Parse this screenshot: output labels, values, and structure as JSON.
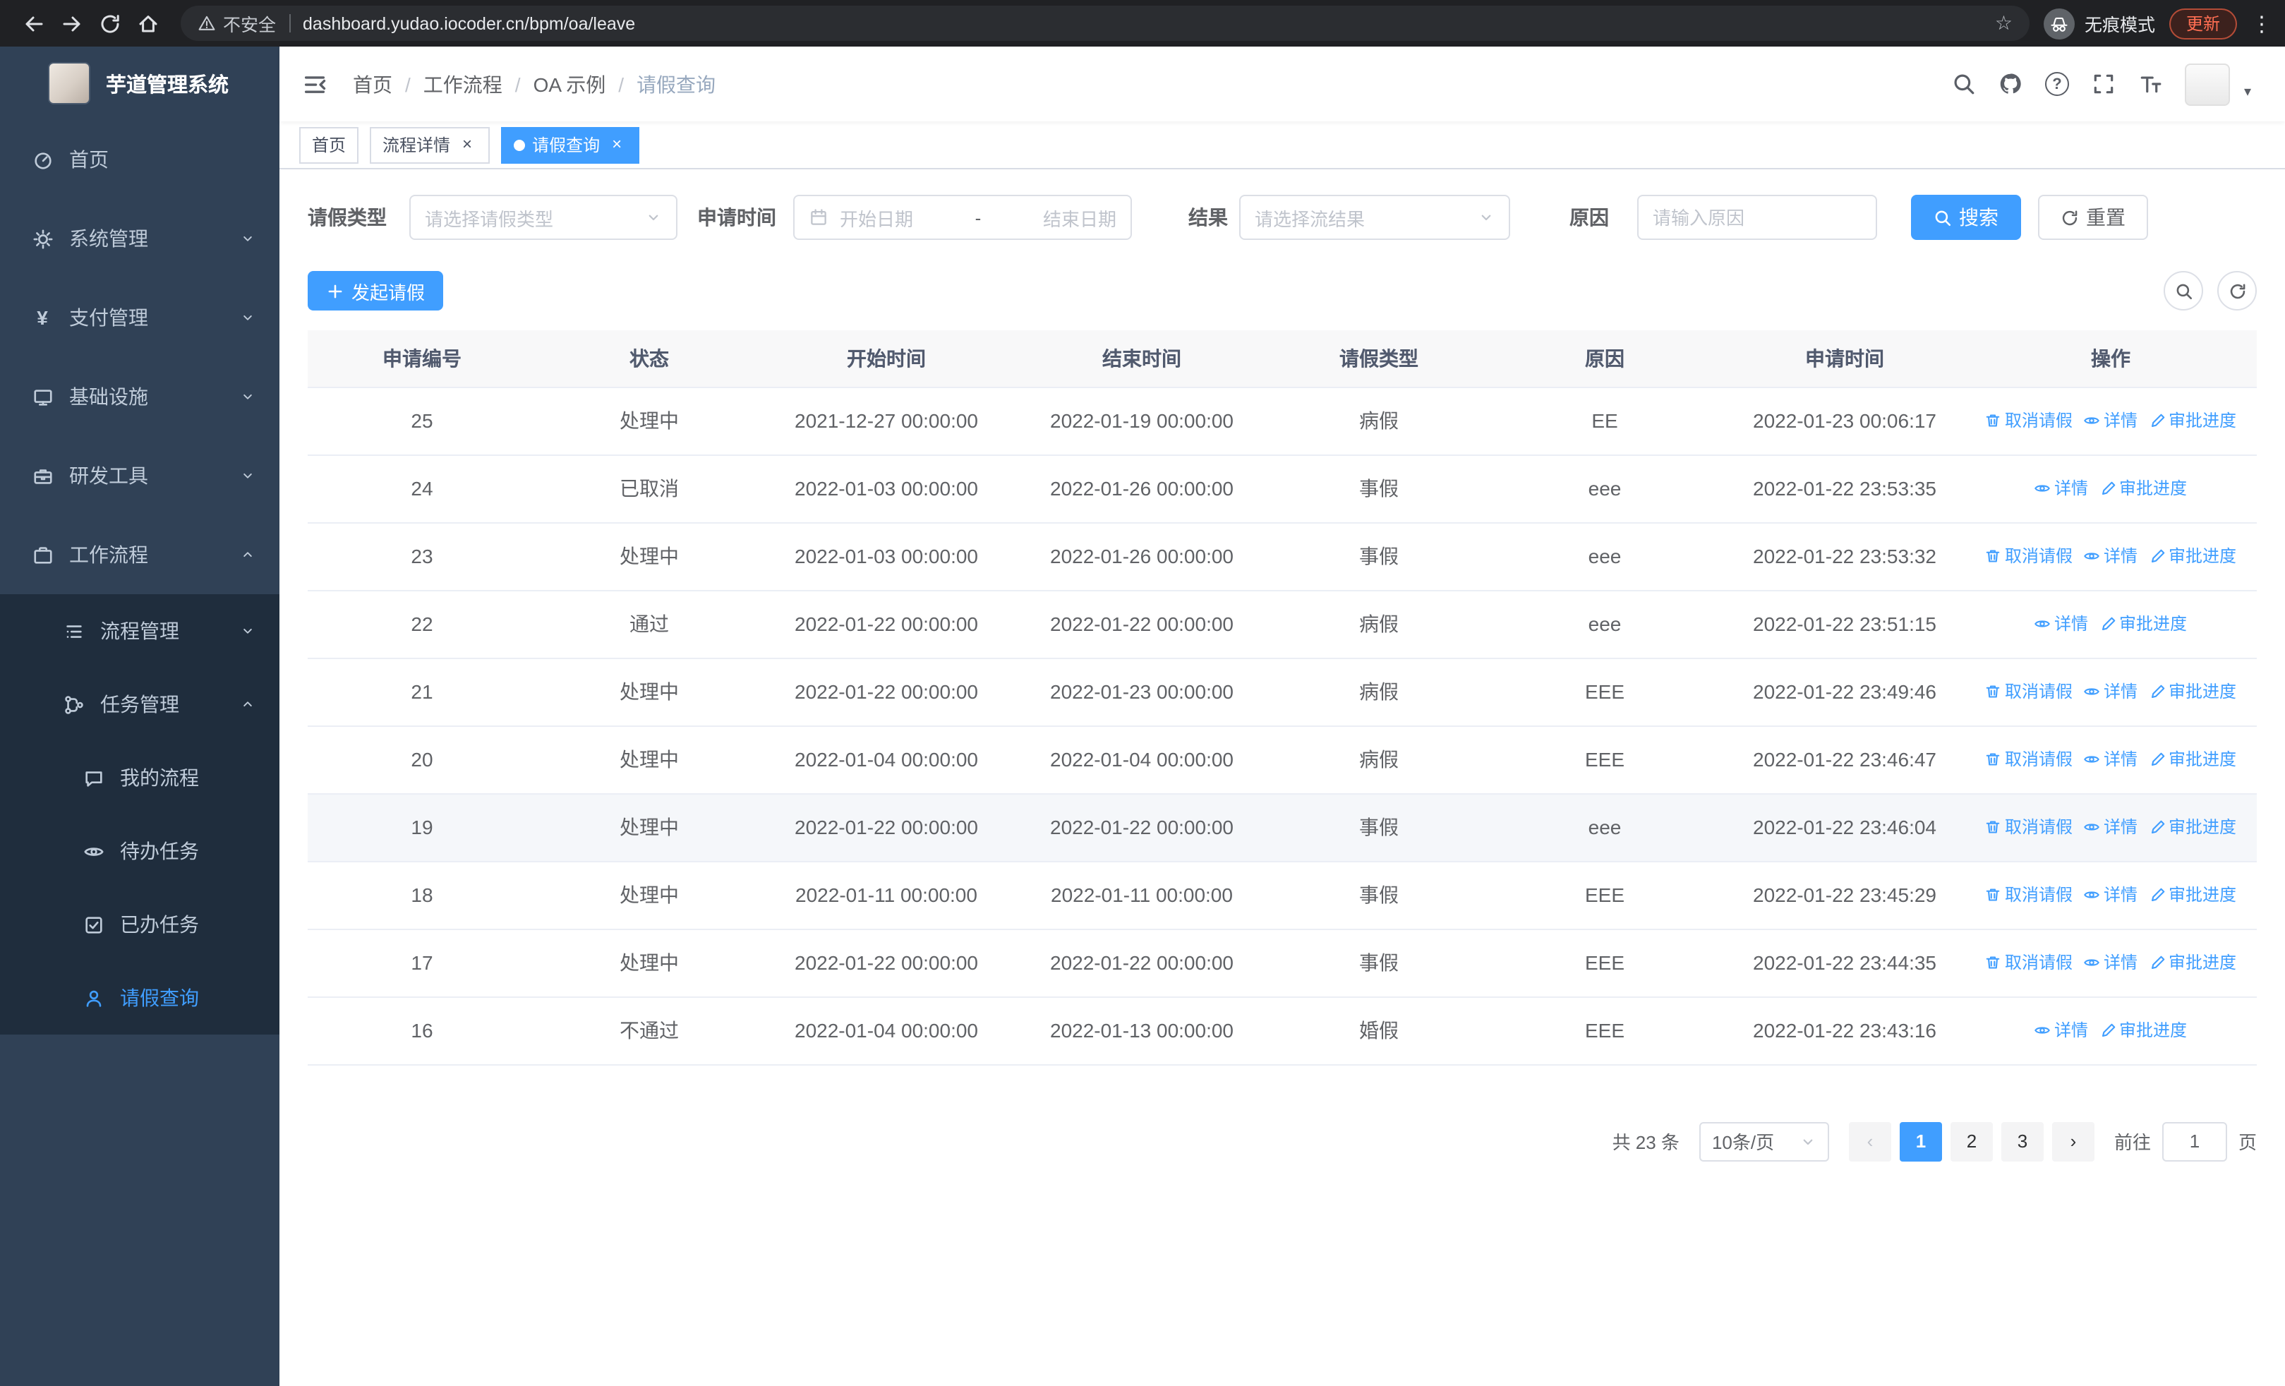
{
  "colors": {
    "accent": "#409eff",
    "sidebar_bg": "#304156",
    "submenu_bg": "#1f2d3d",
    "chrome_bg": "#202124"
  },
  "browser": {
    "security_warning": "不安全",
    "url": "dashboard.yudao.iocoder.cn/bpm/oa/leave",
    "incognito_label": "无痕模式",
    "update_button": "更新"
  },
  "sidebar": {
    "logo_title": "芋道管理系统",
    "menu": [
      {
        "key": "home",
        "label": "首页",
        "icon": "dashboard-icon",
        "expandable": false,
        "expanded": false,
        "active": false
      },
      {
        "key": "system",
        "label": "系统管理",
        "icon": "gear-icon",
        "expandable": true,
        "expanded": false,
        "active": false
      },
      {
        "key": "payment",
        "label": "支付管理",
        "icon": "yen-icon",
        "expandable": true,
        "expanded": false,
        "active": false
      },
      {
        "key": "infrastructure",
        "label": "基础设施",
        "icon": "monitor-icon",
        "expandable": true,
        "expanded": false,
        "active": false
      },
      {
        "key": "devtools",
        "label": "研发工具",
        "icon": "toolbox-icon",
        "expandable": true,
        "expanded": false,
        "active": false
      },
      {
        "key": "workflow",
        "label": "工作流程",
        "icon": "briefcase-icon",
        "expandable": true,
        "expanded": true,
        "active": false
      }
    ],
    "submenu": [
      {
        "key": "process-management",
        "label": "流程管理",
        "icon": "flow-icon",
        "expandable": true,
        "expanded": false,
        "active": false
      },
      {
        "key": "task-management",
        "label": "任务管理",
        "icon": "branch-icon",
        "expandable": true,
        "expanded": true,
        "active": false
      }
    ],
    "task_items": [
      {
        "key": "my-process",
        "label": "我的流程",
        "icon": "chat-icon",
        "active": false
      },
      {
        "key": "todo-tasks",
        "label": "待办任务",
        "icon": "eye-icon",
        "active": false
      },
      {
        "key": "done-tasks",
        "label": "已办任务",
        "icon": "check-square-icon",
        "active": false
      },
      {
        "key": "leave-query",
        "label": "请假查询",
        "icon": "user-icon",
        "active": true
      }
    ]
  },
  "header": {
    "breadcrumb": [
      "首页",
      "工作流程",
      "OA 示例",
      "请假查询"
    ]
  },
  "tabs": [
    {
      "key": "home",
      "label": "首页",
      "closable": false,
      "active": false
    },
    {
      "key": "process-detail",
      "label": "流程详情",
      "closable": true,
      "active": false
    },
    {
      "key": "leave-query",
      "label": "请假查询",
      "closable": true,
      "active": true
    }
  ],
  "filters": {
    "leave_type_label": "请假类型",
    "leave_type_placeholder": "请选择请假类型",
    "apply_time_label": "申请时间",
    "start_date_placeholder": "开始日期",
    "range_separator": "-",
    "end_date_placeholder": "结束日期",
    "result_label": "结果",
    "result_placeholder": "请选择流结果",
    "reason_label": "原因",
    "reason_placeholder": "请输入原因",
    "search_button": "搜索",
    "reset_button": "重置"
  },
  "toolbar": {
    "create_button": "发起请假"
  },
  "table": {
    "columns": [
      "申请编号",
      "状态",
      "开始时间",
      "结束时间",
      "请假类型",
      "原因",
      "申请时间",
      "操作"
    ],
    "action_labels": {
      "cancel": "取消请假",
      "detail": "详情",
      "progress": "审批进度"
    },
    "rows": [
      {
        "id": "25",
        "status": "处理中",
        "start": "2021-12-27 00:00:00",
        "end": "2022-01-19 00:00:00",
        "type": "病假",
        "reason": "EE",
        "apply_time": "2022-01-23 00:06:17",
        "hover": false,
        "actions": [
          "cancel",
          "detail",
          "progress"
        ]
      },
      {
        "id": "24",
        "status": "已取消",
        "start": "2022-01-03 00:00:00",
        "end": "2022-01-26 00:00:00",
        "type": "事假",
        "reason": "eee",
        "apply_time": "2022-01-22 23:53:35",
        "hover": false,
        "actions": [
          "detail",
          "progress"
        ]
      },
      {
        "id": "23",
        "status": "处理中",
        "start": "2022-01-03 00:00:00",
        "end": "2022-01-26 00:00:00",
        "type": "事假",
        "reason": "eee",
        "apply_time": "2022-01-22 23:53:32",
        "hover": false,
        "actions": [
          "cancel",
          "detail",
          "progress"
        ]
      },
      {
        "id": "22",
        "status": "通过",
        "start": "2022-01-22 00:00:00",
        "end": "2022-01-22 00:00:00",
        "type": "病假",
        "reason": "eee",
        "apply_time": "2022-01-22 23:51:15",
        "hover": false,
        "actions": [
          "detail",
          "progress"
        ]
      },
      {
        "id": "21",
        "status": "处理中",
        "start": "2022-01-22 00:00:00",
        "end": "2022-01-23 00:00:00",
        "type": "病假",
        "reason": "EEE",
        "apply_time": "2022-01-22 23:49:46",
        "hover": false,
        "actions": [
          "cancel",
          "detail",
          "progress"
        ]
      },
      {
        "id": "20",
        "status": "处理中",
        "start": "2022-01-04 00:00:00",
        "end": "2022-01-04 00:00:00",
        "type": "病假",
        "reason": "EEE",
        "apply_time": "2022-01-22 23:46:47",
        "hover": false,
        "actions": [
          "cancel",
          "detail",
          "progress"
        ]
      },
      {
        "id": "19",
        "status": "处理中",
        "start": "2022-01-22 00:00:00",
        "end": "2022-01-22 00:00:00",
        "type": "事假",
        "reason": "eee",
        "apply_time": "2022-01-22 23:46:04",
        "hover": true,
        "actions": [
          "cancel",
          "detail",
          "progress"
        ]
      },
      {
        "id": "18",
        "status": "处理中",
        "start": "2022-01-11 00:00:00",
        "end": "2022-01-11 00:00:00",
        "type": "事假",
        "reason": "EEE",
        "apply_time": "2022-01-22 23:45:29",
        "hover": false,
        "actions": [
          "cancel",
          "detail",
          "progress"
        ]
      },
      {
        "id": "17",
        "status": "处理中",
        "start": "2022-01-22 00:00:00",
        "end": "2022-01-22 00:00:00",
        "type": "事假",
        "reason": "EEE",
        "apply_time": "2022-01-22 23:44:35",
        "hover": false,
        "actions": [
          "cancel",
          "detail",
          "progress"
        ]
      },
      {
        "id": "16",
        "status": "不通过",
        "start": "2022-01-04 00:00:00",
        "end": "2022-01-13 00:00:00",
        "type": "婚假",
        "reason": "EEE",
        "apply_time": "2022-01-22 23:43:16",
        "hover": false,
        "actions": [
          "detail",
          "progress"
        ]
      }
    ]
  },
  "pagination": {
    "total_text": "共 23 条",
    "page_size": "10条/页",
    "pages": [
      "1",
      "2",
      "3"
    ],
    "active_page": "1",
    "goto_label": "前往",
    "goto_value": "1",
    "goto_suffix": "页"
  }
}
